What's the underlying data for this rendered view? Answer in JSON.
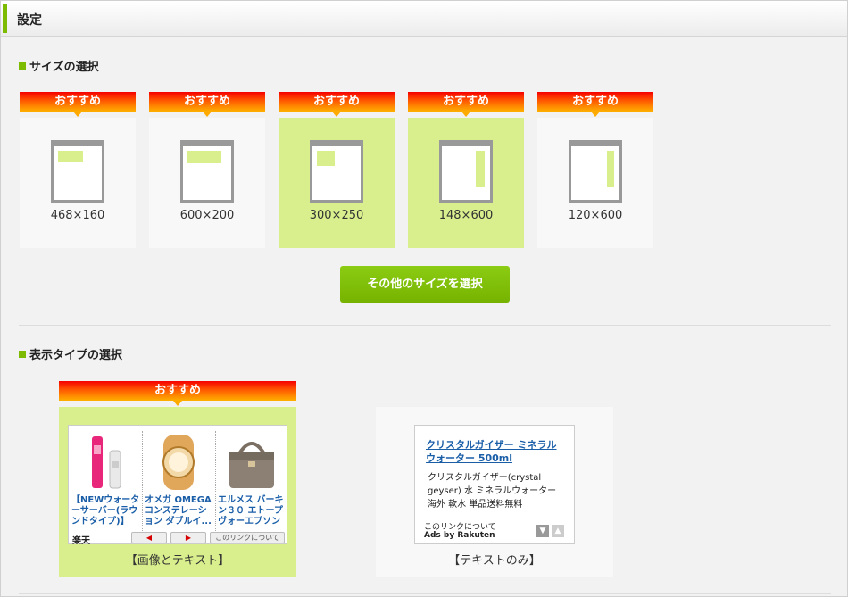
{
  "header": {
    "title": "設定"
  },
  "size_section": {
    "title": "サイズの選択",
    "badge": "おすすめ",
    "cards": [
      {
        "label": "468×160",
        "selected": false
      },
      {
        "label": "600×200",
        "selected": false
      },
      {
        "label": "300×250",
        "selected": true
      },
      {
        "label": "148×600",
        "selected": true
      },
      {
        "label": "120×600",
        "selected": false
      }
    ],
    "other_sizes_button": "その他のサイズを選択"
  },
  "type_section": {
    "title": "表示タイプの選択",
    "badge": "おすすめ",
    "image_text": {
      "label": "【画像とテキスト】",
      "selected": true,
      "products": [
        {
          "text": "【NEWウォーターサーバー(ラウンドタイプ)】"
        },
        {
          "text": "オメガ OMEGA コンステレーション ダブルイ..."
        },
        {
          "text": "エルメス バーキン３０ エトープ ヴォーエプソン"
        }
      ],
      "logo": "楽天",
      "about_link": "このリンクについて"
    },
    "text_only": {
      "label": "【テキストのみ】",
      "ad_title": "クリスタルガイザー ミネラルウォーター 500ml",
      "ad_desc": "クリスタルガイザー(crystal geyser) 水 ミネラルウォーター 海外 軟水 単品送料無料",
      "about_link": "このリンクについて",
      "ads_by": "Ads by Rakuten"
    }
  },
  "colors": {
    "accent": "#7cbb00",
    "selected_bg": "#d9ef8e",
    "badge_top": "#f60000",
    "badge_bottom": "#ffb000"
  }
}
